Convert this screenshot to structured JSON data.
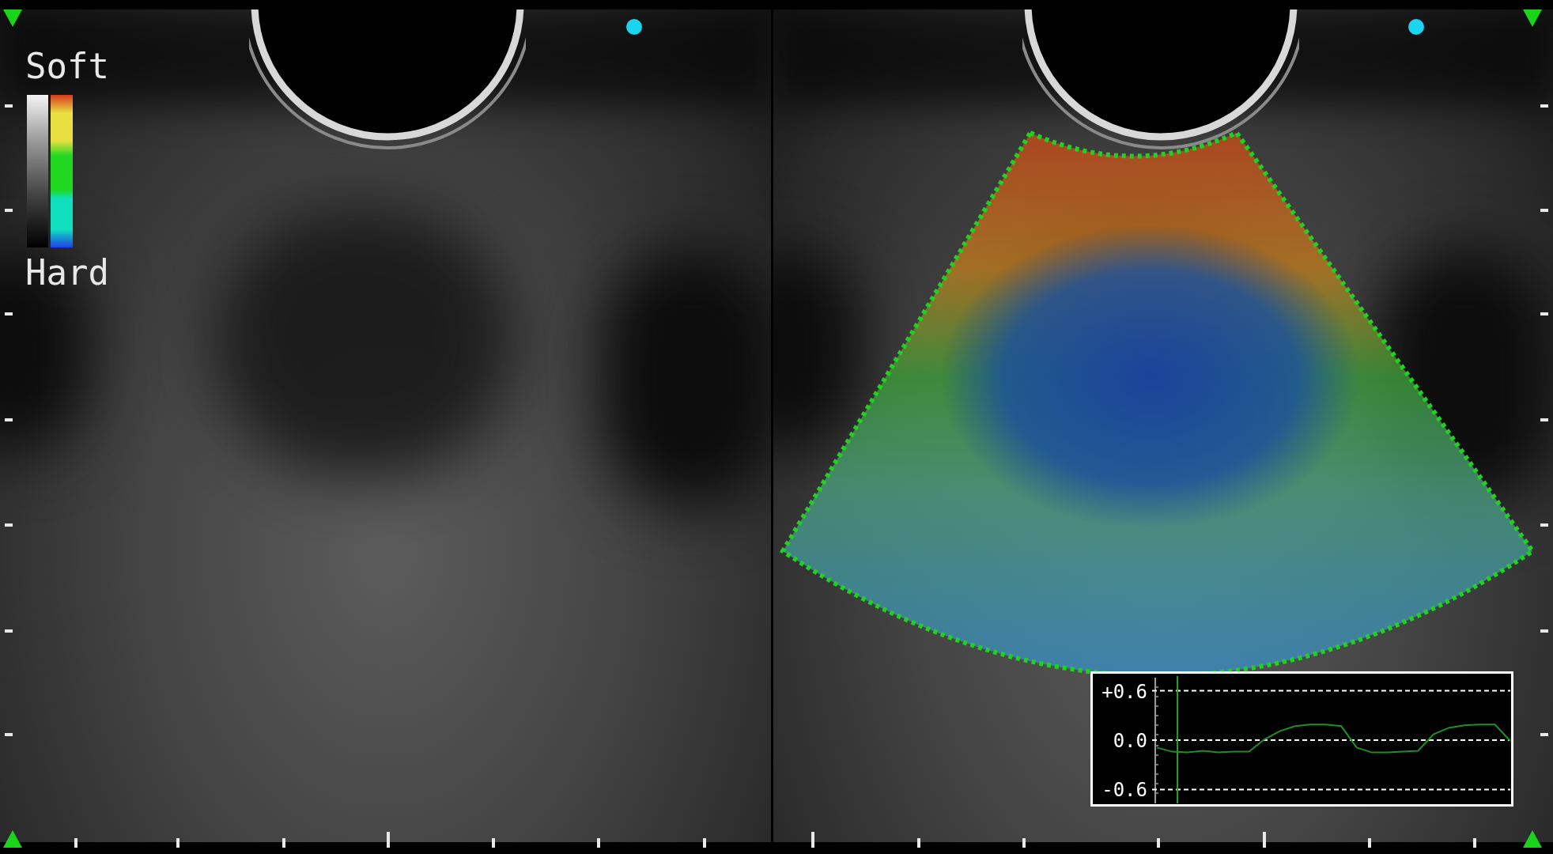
{
  "color_scale": {
    "top_label": "Soft",
    "bottom_label": "Hard"
  },
  "strain_graph": {
    "chart_data": {
      "type": "line",
      "grid": "y",
      "ylim": [
        -0.75,
        0.75
      ],
      "yticks": [
        {
          "value": 0.6,
          "label": "+0.6"
        },
        {
          "value": 0,
          "label": "0.0"
        },
        {
          "value": -0.6,
          "label": "-0.6"
        }
      ],
      "categories": [
        null,
        null,
        null,
        null,
        null,
        null,
        null,
        null,
        null,
        null,
        null,
        null,
        null,
        null,
        null,
        null,
        null,
        null,
        null,
        null,
        null,
        null,
        null,
        null
      ],
      "series": [
        {
          "color": "#1f8f1f",
          "values": [
            -0.09,
            -0.14,
            -0.15,
            -0.13,
            -0.15,
            -0.14,
            -0.14,
            0.01,
            0.11,
            0.17,
            0.19,
            0.19,
            0.17,
            -0.09,
            -0.15,
            -0.15,
            -0.14,
            -0.13,
            0.07,
            0.15,
            0.18,
            0.19,
            0.19,
            -0.01
          ]
        }
      ]
    }
  }
}
